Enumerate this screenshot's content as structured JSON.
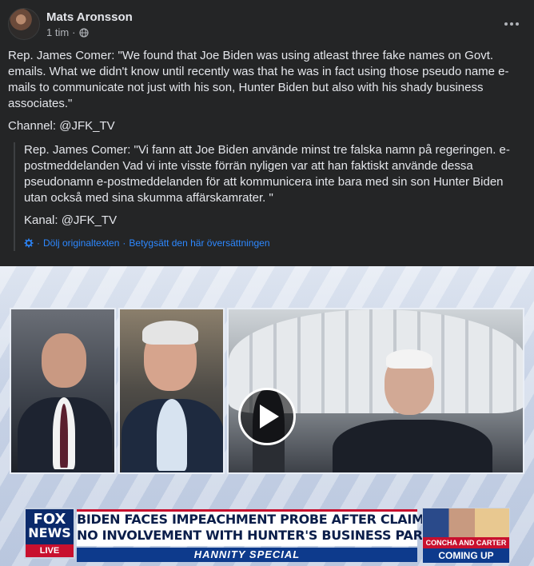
{
  "post": {
    "author": "Mats Aronsson",
    "time": "1 tim",
    "dot": "·",
    "privacy_icon": "globe-icon",
    "more_icon": "more-icon",
    "text_paragraph_1": "Rep. James Comer: \"We found that Joe Biden was using atleast three fake names on Govt. emails. What we didn't know until recently was that he was in fact using those pseudo name e-mails to communicate not just with his son, Hunter Biden but also with his shady business associates.\"",
    "text_paragraph_2": "Channel: @JFK_TV"
  },
  "translation": {
    "paragraph_1": "Rep. James Comer: \"Vi fann att Joe Biden använde minst tre falska namn på regeringen. e-postmeddelanden Vad vi inte visste förrän nyligen var att han faktiskt använde dessa pseudonamn e-postmeddelanden för att kommunicera inte bara med sin son Hunter Biden utan också med sina skumma affärskamrater. \"",
    "paragraph_2": "Kanal: @JFK_TV",
    "hide_original": "Dölj originaltexten",
    "rate_translation": "Betygsätt den här översättningen",
    "separator": "·",
    "icon": "gear-icon"
  },
  "video": {
    "play_icon": "play-icon",
    "chyron_line_1": "BIDEN FACES IMPEACHMENT PROBE AFTER CLAIMING",
    "chyron_line_2": "NO INVOLVEMENT WITH HUNTER'S BUSINESS PARTNERS",
    "show_name": "HANNITY SPECIAL",
    "logo_fox": "FOX",
    "logo_news": "NEWS",
    "live": "LIVE",
    "coming_names": "CONCHA AND CARTER",
    "coming_up": "COMING UP"
  }
}
